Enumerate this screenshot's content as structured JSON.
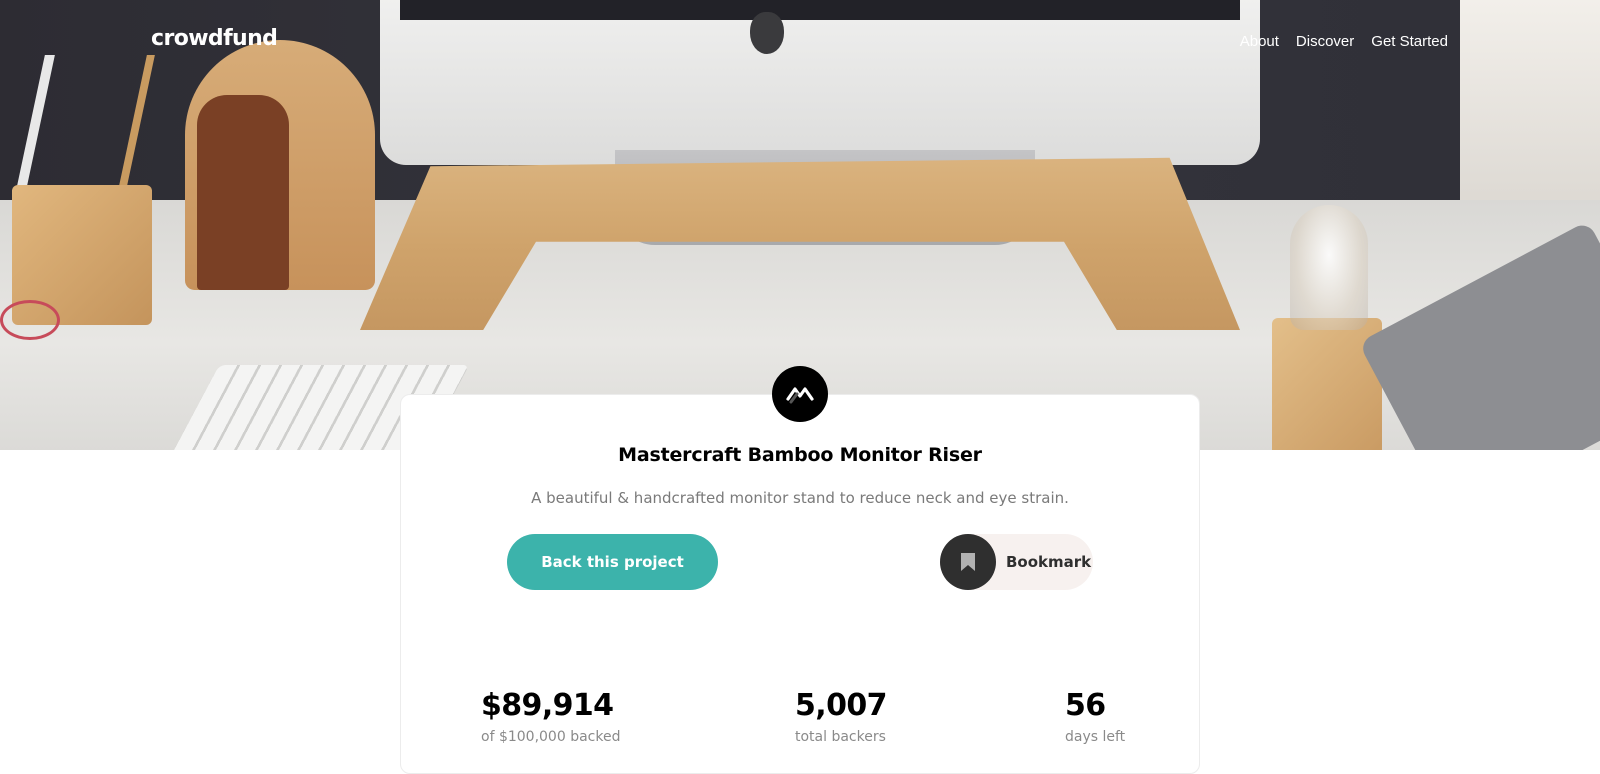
{
  "header": {
    "logo": "crowdfund",
    "nav": [
      "About",
      "Discover",
      "Get Started"
    ]
  },
  "hero": {
    "image": "desk-with-monitor-riser-photo"
  },
  "project": {
    "title": "Mastercraft Bamboo Monitor Riser",
    "description": "A beautiful & handcrafted monitor stand to reduce neck and eye strain.",
    "back_label": "Back this project",
    "bookmark_label": "Bookmark"
  },
  "stats": [
    {
      "value": "$89,914",
      "label": "of $100,000 backed"
    },
    {
      "value": "5,007",
      "label": "total backers"
    },
    {
      "value": "56",
      "label": "days left"
    }
  ],
  "colors": {
    "accent": "#3cb3ab",
    "dark": "#2f2f2f",
    "muted": "#7a7a7a"
  }
}
